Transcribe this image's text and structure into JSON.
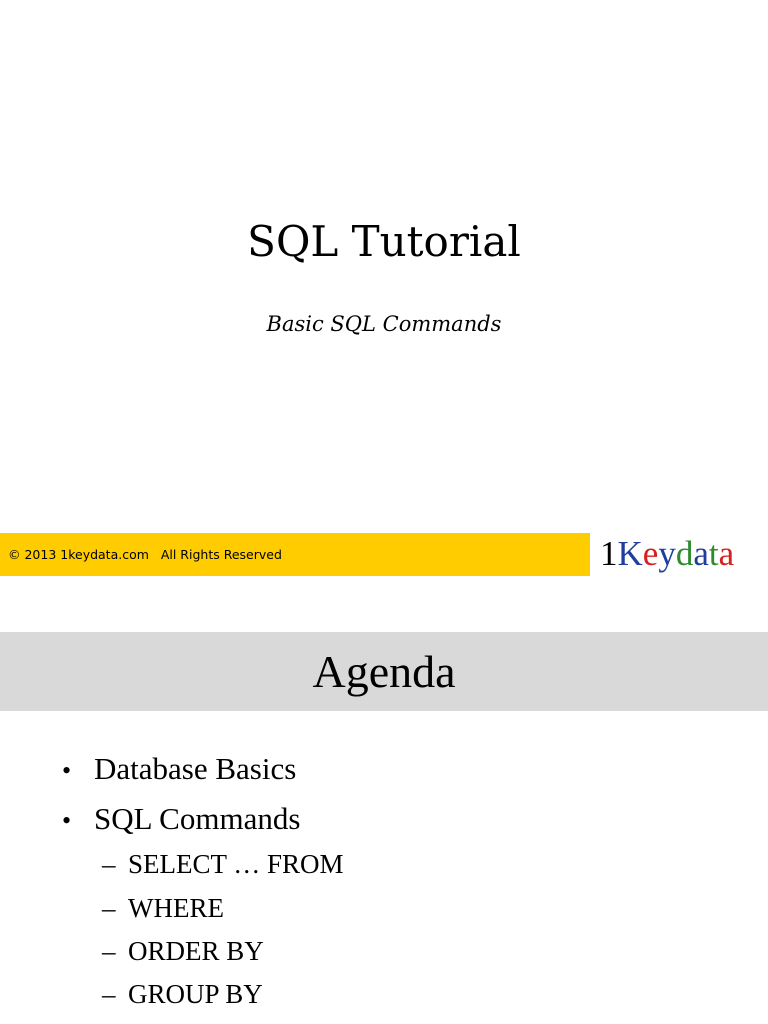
{
  "slide1": {
    "title": "SQL Tutorial",
    "subtitle": "Basic SQL Commands",
    "footer_text": "© 2013 1keydata.com   All Rights Reserved",
    "footer_color": "#ffcc00",
    "logo": {
      "letters": [
        {
          "char": "1",
          "color": "#000000"
        },
        {
          "char": "K",
          "color": "#1f3f9f"
        },
        {
          "char": "e",
          "color": "#d42020"
        },
        {
          "char": "y",
          "color": "#1f3f9f"
        },
        {
          "char": "d",
          "color": "#2e8b2e"
        },
        {
          "char": "a",
          "color": "#1f3f9f"
        },
        {
          "char": "t",
          "color": "#2e8b2e"
        },
        {
          "char": "a",
          "color": "#d42020"
        }
      ]
    }
  },
  "slide2": {
    "title": "Agenda",
    "title_band_color": "#d9d9d9",
    "bullets": [
      {
        "marker": "•",
        "text": "Database Basics"
      },
      {
        "marker": "•",
        "text": "SQL Commands"
      }
    ],
    "subitems": [
      {
        "marker": "–",
        "text": "SELECT … FROM"
      },
      {
        "marker": "–",
        "text": "WHERE"
      },
      {
        "marker": "–",
        "text": "ORDER BY"
      },
      {
        "marker": "–",
        "text": "GROUP BY"
      }
    ]
  }
}
